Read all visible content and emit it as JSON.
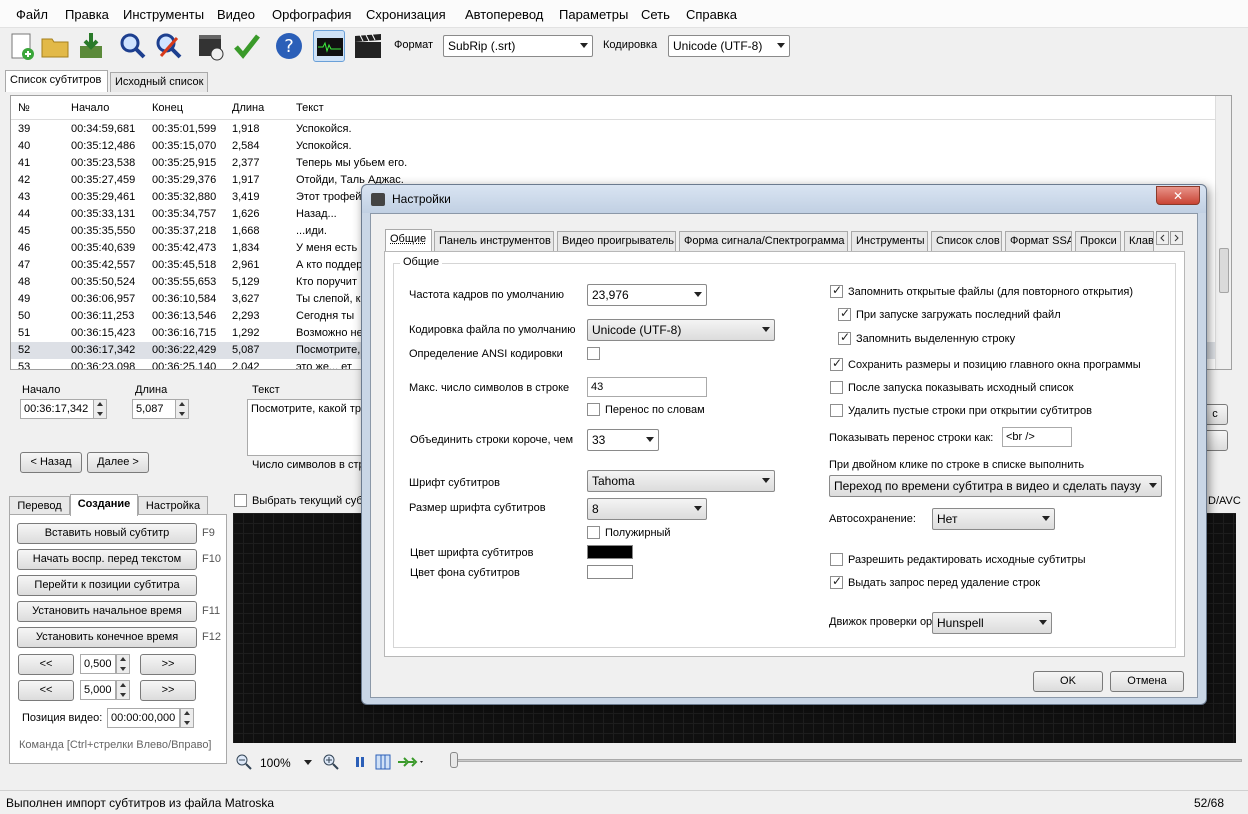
{
  "menu": [
    "Файл",
    "Правка",
    "Инструменты",
    "Видео",
    "Орфография",
    "Схронизация",
    "Автоперевод",
    "Параметры",
    "Сеть",
    "Справка"
  ],
  "toolbar": {
    "format_label": "Формат",
    "format_value": "SubRip (.srt)",
    "encoding_label": "Кодировка",
    "encoding_value": "Unicode (UTF-8)"
  },
  "main_tabs": [
    "Список субтитров",
    "Исходный список"
  ],
  "list": {
    "headers": [
      "№",
      "Начало",
      "Конец",
      "Длина",
      "Текст"
    ],
    "rows": [
      [
        "39",
        "00:34:59,681",
        "00:35:01,599",
        "1,918",
        "Успокойся."
      ],
      [
        "40",
        "00:35:12,486",
        "00:35:15,070",
        "2,584",
        "Успокойся."
      ],
      [
        "41",
        "00:35:23,538",
        "00:35:25,915",
        "2,377",
        "Теперь мы убьем его."
      ],
      [
        "42",
        "00:35:27,459",
        "00:35:29,376",
        "1,917",
        "Отойди, Таль Аджас."
      ],
      [
        "43",
        "00:35:29,461",
        "00:35:32,880",
        "3,419",
        "Этот трофей"
      ],
      [
        "44",
        "00:35:33,131",
        "00:35:34,757",
        "1,626",
        "Назад..."
      ],
      [
        "45",
        "00:35:35,550",
        "00:35:37,218",
        "1,668",
        "...иди."
      ],
      [
        "46",
        "00:35:40,639",
        "00:35:42,473",
        "1,834",
        "У меня есть г"
      ],
      [
        "47",
        "00:35:42,557",
        "00:35:45,518",
        "2,961",
        "А кто поддер"
      ],
      [
        "48",
        "00:35:50,524",
        "00:35:55,653",
        "5,129",
        "Кто поручит"
      ],
      [
        "49",
        "00:36:06,957",
        "00:36:10,584",
        "3,627",
        "Ты слепой, к"
      ],
      [
        "50",
        "00:36:11,253",
        "00:36:13,546",
        "2,293",
        "Сегодня ты"
      ],
      [
        "51",
        "00:36:15,423",
        "00:36:16,715",
        "1,292",
        "Возможно не"
      ],
      [
        "52",
        "00:36:17,342",
        "00:36:22,429",
        "5,087",
        "Посмотрите,"
      ],
      [
        "53",
        "00:36:23,098",
        "00:36:25,140",
        "2,042",
        "это же... ет"
      ]
    ]
  },
  "editor": {
    "start_label": "Начало",
    "start_value": "00:36:17,342",
    "duration_label": "Длина",
    "duration_value": "5,087",
    "text_label": "Текст",
    "text_value": "Посмотрите, какой тр",
    "prev_btn": "< Назад",
    "next_btn": "Далее >",
    "char_count": "Число символов в стр",
    "right_btn": "с"
  },
  "left_tabs": [
    "Перевод",
    "Создание",
    "Настройка"
  ],
  "create_panel": {
    "buttons": [
      {
        "label": "Вставить новый субтитр",
        "key": "F9"
      },
      {
        "label": "Начать воспр. перед текстом",
        "key": "F10"
      },
      {
        "label": "Перейти к позиции субтитра",
        "key": ""
      },
      {
        "label": "Установить начальное время",
        "key": "F11"
      },
      {
        "label": "Установить конечное время",
        "key": "F12"
      }
    ],
    "step1": "0,500",
    "step2": "5,000",
    "back": "<<",
    "fwd": ">>",
    "video_pos_label": "Позиция видео:",
    "video_pos": "00:00:00,000",
    "hint": "Команда [Ctrl+стрелки Влево/Вправо]"
  },
  "select_current": "Выбрать текущий субт",
  "avc": "D/AVC",
  "zoom": "100%",
  "status": {
    "text": "Выполнен импорт субтитров из файла Matroska",
    "pos": "52/68"
  },
  "dialog": {
    "title": "Настройки",
    "close": "✕",
    "tabs": [
      "Общие",
      "Панель инструментов",
      "Видео проигрыватель",
      "Форма сигнала/Спектрограмма",
      "Инструменты",
      "Список слов",
      "Формат SSA",
      "Прокси",
      "Клав"
    ],
    "group": "Общие",
    "left": {
      "fps_label": "Частота кадров по умолчанию",
      "fps": "23,976",
      "enc_label": "Кодировка файла по умолчанию",
      "enc": "Unicode (UTF-8)",
      "ansi_label": "Определение ANSI кодировки",
      "maxchars_label": "Макс. число символов в строке",
      "maxchars": "43",
      "wrap_label": "Перенос по словам",
      "merge_label": "Объединить строки короче, чем",
      "merge": "33",
      "font_label": "Шрифт субтитров",
      "font": "Tahoma",
      "size_label": "Размер шрифта субтитров",
      "size": "8",
      "bold_label": "Полужирный",
      "color_label": "Цвет шрифта субтитров",
      "bg_label": "Цвет фона субтитров",
      "font_color": "#000000",
      "bg_color": "#ffffff"
    },
    "right": {
      "remember": "Запомнить открытые файлы (для повторного открытия)",
      "load_last": "При запуске загружать последний файл",
      "remember_sel": "Запомнить выделенную строку",
      "save_size": "Сохранить размеры и позицию главного окна программы",
      "show_orig": "После запуска показывать исходный список",
      "del_empty": "Удалить пустые строки при открытии субтитров",
      "br_label": "Показывать перенос строки как:",
      "br": "<br />",
      "dbl_label": "При двойном клике по строке в списке выполнить",
      "dbl": "Переход по времени субтитра в видео и сделать паузу",
      "autosave_label": "Автосохранение:",
      "autosave": "Нет",
      "edit_orig": "Разрешить редактировать исходные субтитры",
      "confirm_del": "Выдать запрос перед удаление строк",
      "spell_label": "Движок проверки ор",
      "spell": "Hunspell"
    },
    "ok": "OK",
    "cancel": "Отмена"
  }
}
